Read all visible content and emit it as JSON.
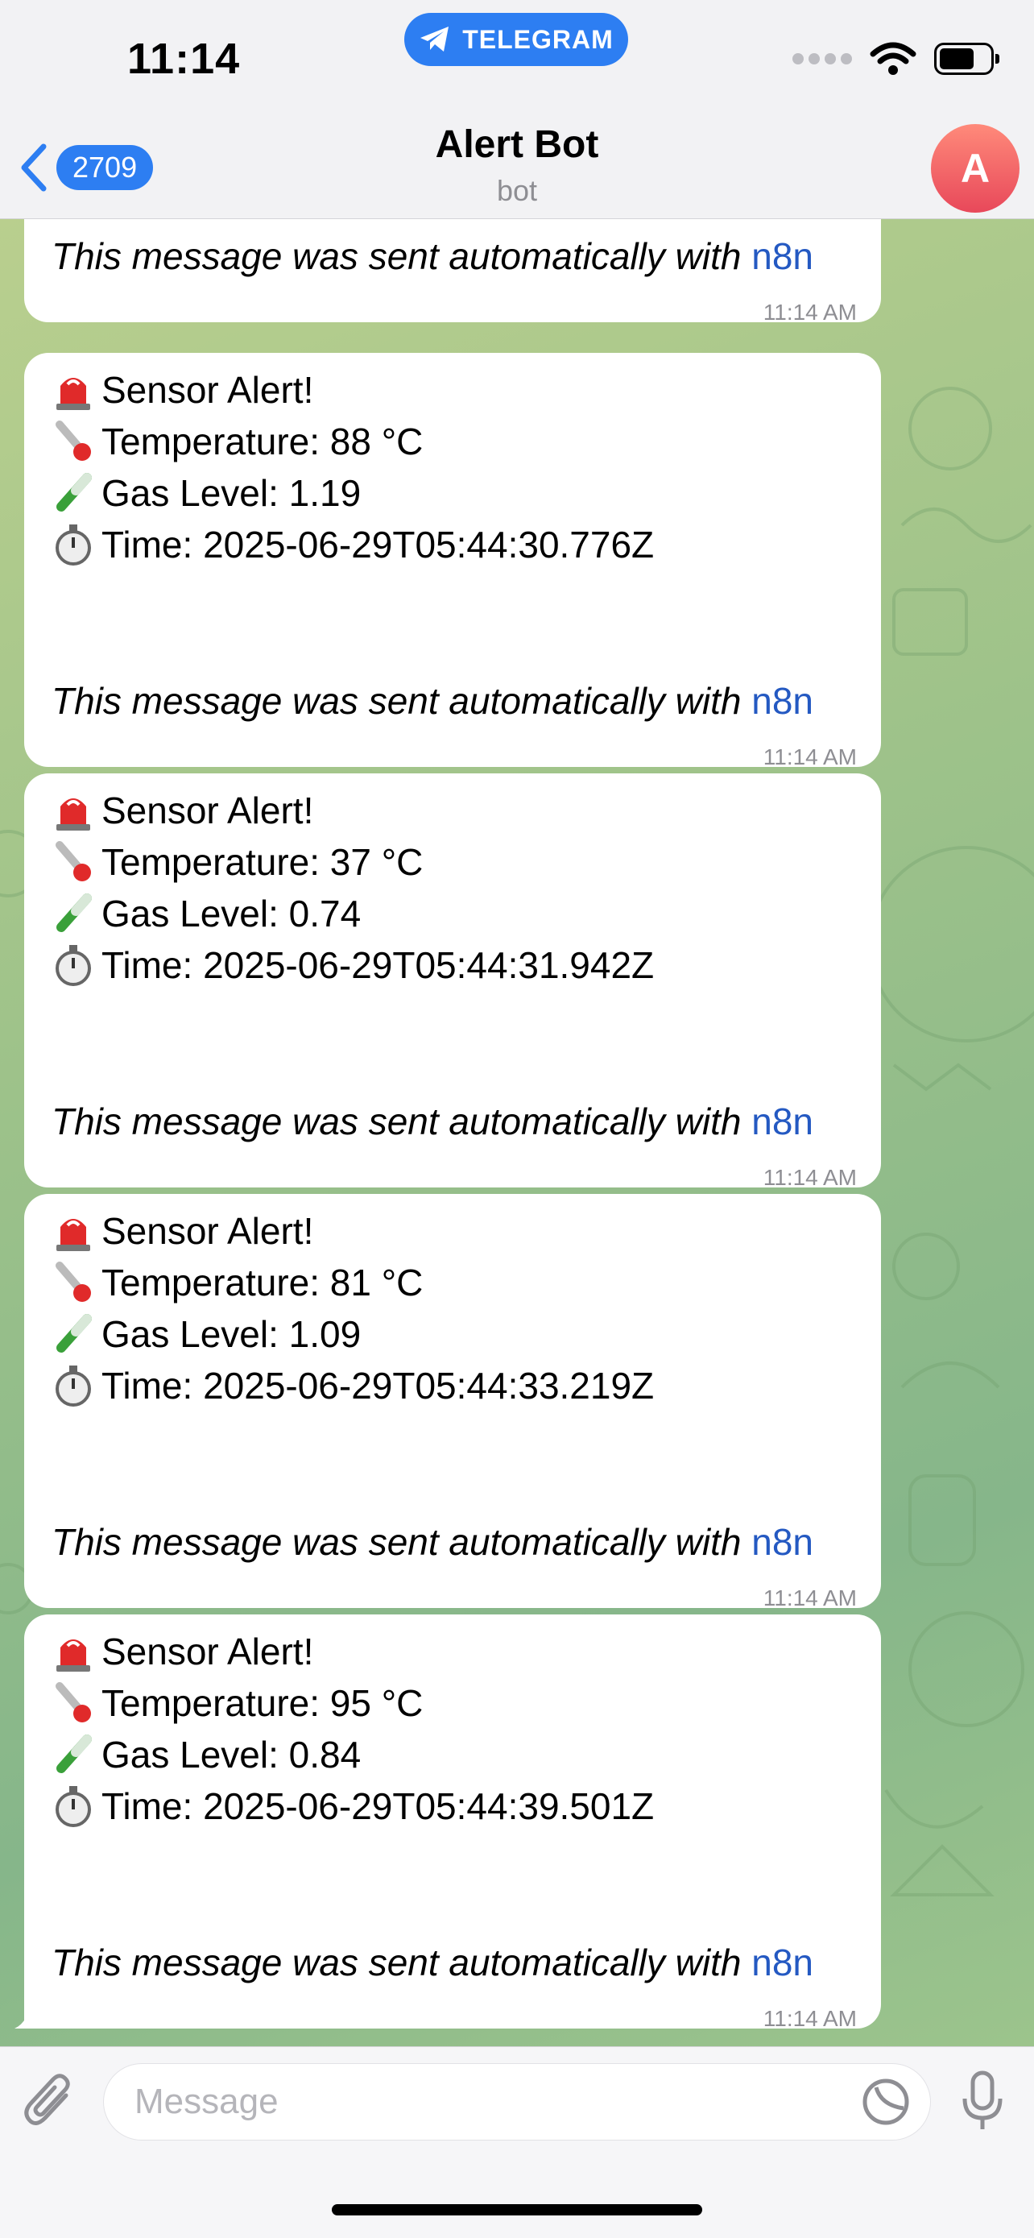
{
  "status_bar": {
    "time": "11:14",
    "source_app": "TELEGRAM",
    "icons": [
      "signal-dots-icon",
      "wifi-icon",
      "battery-icon"
    ],
    "battery_level": 0.7
  },
  "header": {
    "back_count": "2709",
    "title": "Alert Bot",
    "subtitle": "bot",
    "avatar_letter": "A"
  },
  "messages": [
    {
      "footer_text": "This message was sent automatically with ",
      "footer_link": "n8n",
      "time": "11:14 AM"
    },
    {
      "heading": "Sensor Alert!",
      "temperature": "Temperature: 88 °C",
      "gas": "Gas Level: 1.19",
      "timestamp": "Time: 2025-06-29T05:44:30.776Z",
      "footer_text": "This message was sent automatically with ",
      "footer_link": "n8n",
      "time": "11:14 AM"
    },
    {
      "heading": "Sensor Alert!",
      "temperature": "Temperature: 37 °C",
      "gas": "Gas Level: 0.74",
      "timestamp": "Time: 2025-06-29T05:44:31.942Z",
      "footer_text": "This message was sent automatically with ",
      "footer_link": "n8n",
      "time": "11:14 AM"
    },
    {
      "heading": "Sensor Alert!",
      "temperature": "Temperature: 81 °C",
      "gas": "Gas Level: 1.09",
      "timestamp": "Time: 2025-06-29T05:44:33.219Z",
      "footer_text": "This message was sent automatically with ",
      "footer_link": "n8n",
      "time": "11:14 AM"
    },
    {
      "heading": "Sensor Alert!",
      "temperature": "Temperature: 95 °C",
      "gas": "Gas Level: 0.84",
      "timestamp": "Time: 2025-06-29T05:44:39.501Z",
      "footer_text": "This message was sent automatically with ",
      "footer_link": "n8n",
      "time": "11:14 AM"
    }
  ],
  "message_emojis": [
    "siren-icon",
    "thermometer-icon",
    "test-tube-icon",
    "stopwatch-icon"
  ],
  "composer": {
    "placeholder": "Message",
    "icons": [
      "attach-icon",
      "sticker-icon",
      "microphone-icon"
    ]
  },
  "colors": {
    "accent": "#2d7ef2",
    "link": "#2459c2",
    "avatar": "#ef5f6a",
    "wallpaper": "#a3c58b"
  }
}
